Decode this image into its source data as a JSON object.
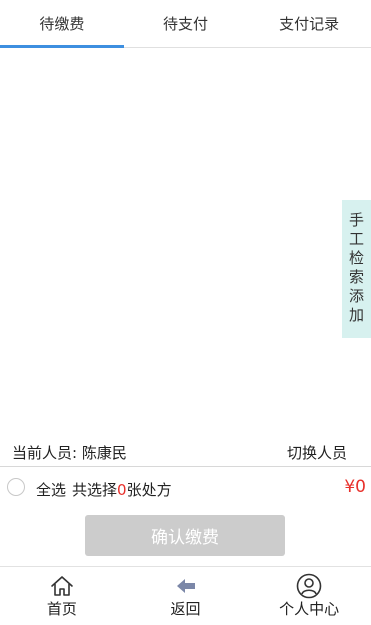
{
  "tabs": [
    {
      "label": "待缴费",
      "active": true
    },
    {
      "label": "待支付",
      "active": false
    },
    {
      "label": "支付记录",
      "active": false
    }
  ],
  "side_button": {
    "label": "手工检索添加"
  },
  "person": {
    "label": "当前人员: ",
    "name": "陈康民",
    "switch_label": "切换人员"
  },
  "selection": {
    "select_all_label": "全选",
    "count_prefix": "共选择",
    "count": "0",
    "count_suffix": "张处方",
    "total": "¥0"
  },
  "confirm_button": {
    "label": "确认缴费"
  },
  "bottom_nav": [
    {
      "label": "首页",
      "icon": "home-icon"
    },
    {
      "label": "返回",
      "icon": "back-arrow-icon"
    },
    {
      "label": "个人中心",
      "icon": "user-circle-icon"
    }
  ],
  "colors": {
    "accent": "#3d8fe0",
    "side_button_bg": "#d7f1ef",
    "price_red": "#e8302b",
    "button_disabled": "#cccccc",
    "back_icon": "#7b87a8"
  }
}
